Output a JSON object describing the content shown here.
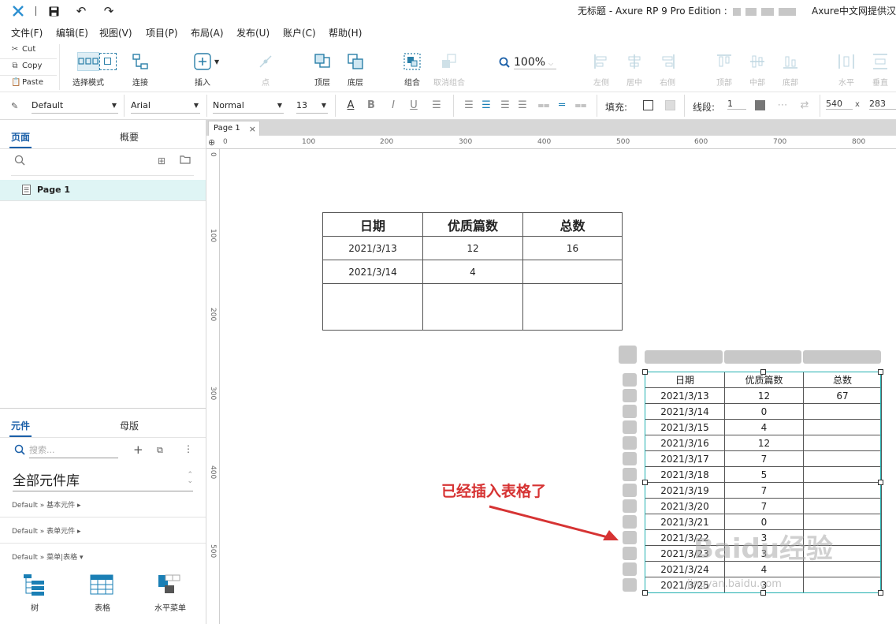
{
  "app": {
    "title": "无标题 - Axure RP 9 Pro Edition :",
    "title_right": "Axure中文网提供汉"
  },
  "menu": [
    "文件(F)",
    "编辑(E)",
    "视图(V)",
    "项目(P)",
    "布局(A)",
    "发布(U)",
    "账户(C)",
    "帮助(H)"
  ],
  "clipboard": {
    "cut": "Cut",
    "copy": "Copy",
    "paste": "Paste"
  },
  "toolbar": {
    "select_mode": "选择模式",
    "connect": "连接",
    "insert": "插入",
    "point": "点",
    "top_layer": "顶层",
    "bottom_layer": "底层",
    "group": "组合",
    "ungroup": "取消组合",
    "zoom": "100%",
    "align_left": "左侧",
    "align_center": "居中",
    "align_right": "右侧",
    "align_top": "顶部",
    "align_middle": "中部",
    "align_bottom": "底部",
    "dist_h": "水平",
    "dist_v": "垂直"
  },
  "format": {
    "style": "Default",
    "font": "Arial",
    "weight": "Normal",
    "size": "13",
    "fill_label": "填充:",
    "line_label": "线段:",
    "line_width": "1",
    "x": "540",
    "x_label": "x",
    "y": "283"
  },
  "pages_panel": {
    "tab_pages": "页面",
    "tab_outline": "概要",
    "page1": "Page 1"
  },
  "widgets_panel": {
    "tab_widgets": "元件",
    "tab_masters": "母版",
    "search_placeholder": "搜索...",
    "library": "全部元件库",
    "group_basic": "Default » 基本元件 ▸",
    "group_form": "Default » 表单元件 ▸",
    "group_menu": "Default » 菜单|表格 ▾",
    "items": [
      "树",
      "表格",
      "水平菜单"
    ]
  },
  "canvas": {
    "tab": "Page 1",
    "hruler": [
      "0",
      "100",
      "200",
      "300",
      "400",
      "500",
      "600",
      "700",
      "800"
    ],
    "vruler": [
      "0",
      "100",
      "200",
      "300",
      "400",
      "500"
    ]
  },
  "big_table": {
    "headers": [
      "日期",
      "优质篇数",
      "总数"
    ],
    "rows": [
      [
        "2021/3/13",
        "12",
        "16"
      ],
      [
        "2021/3/14",
        "4",
        ""
      ],
      [
        "",
        "",
        ""
      ]
    ]
  },
  "small_table": {
    "headers": [
      "日期",
      "优质篇数",
      "总数"
    ],
    "rows": [
      [
        "2021/3/13",
        "12",
        "67"
      ],
      [
        "2021/3/14",
        "0",
        ""
      ],
      [
        "2021/3/15",
        "4",
        ""
      ],
      [
        "2021/3/16",
        "12",
        ""
      ],
      [
        "2021/3/17",
        "7",
        ""
      ],
      [
        "2021/3/18",
        "5",
        ""
      ],
      [
        "2021/3/19",
        "7",
        ""
      ],
      [
        "2021/3/20",
        "7",
        ""
      ],
      [
        "2021/3/21",
        "0",
        ""
      ],
      [
        "2021/3/22",
        "3",
        ""
      ],
      [
        "2021/3/23",
        "3",
        ""
      ],
      [
        "2021/3/24",
        "4",
        ""
      ],
      [
        "2021/3/25",
        "3",
        ""
      ]
    ]
  },
  "annotation": "已经插入表格了",
  "watermark": {
    "main": "Baidu经验",
    "sub": "jingyan.baidu.com"
  },
  "colors": {
    "accent": "#1a5fa8",
    "annotation": "#d63333",
    "selection": "#22b0b0"
  }
}
